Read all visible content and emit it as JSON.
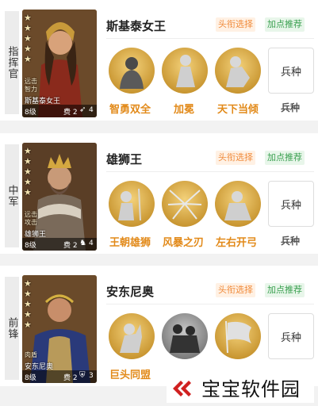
{
  "heroes": [
    {
      "role": "指挥官",
      "name": "斯基泰女王",
      "card": {
        "traits": [
          "远击",
          "智力"
        ],
        "name": "斯基泰女王",
        "level": "8级",
        "cost": "费 2",
        "unit_num": "4",
        "unit_icon": "bow-icon"
      },
      "tag_title": "头衔选择",
      "tag_points": "加点推荐",
      "skills": [
        "智勇双全",
        "加冕",
        "天下当倾"
      ],
      "troop_button": "兵种",
      "troop_label": "兵种"
    },
    {
      "role": "中军",
      "name": "雄狮王",
      "card": {
        "traits": [
          "远击",
          "攻击"
        ],
        "name": "雄狮王",
        "level": "8级",
        "cost": "费 2",
        "unit_num": "4",
        "unit_icon": "horse-icon"
      },
      "tag_title": "头衔选择",
      "tag_points": "加点推荐",
      "skills": [
        "王朝雄狮",
        "风暴之刃",
        "左右开弓"
      ],
      "troop_button": "兵种",
      "troop_label": "兵种"
    },
    {
      "role": "前锋",
      "name": "安东尼奥",
      "card": {
        "traits": [
          "肉盾"
        ],
        "name": "安东尼奥",
        "level": "8级",
        "cost": "费 2",
        "unit_num": "3",
        "unit_icon": "shield-icon"
      },
      "tag_title": "头衔选择",
      "tag_points": "加点推荐",
      "skills": [
        "巨头同盟",
        "",
        ""
      ],
      "troop_button": "兵种",
      "troop_label": ""
    }
  ],
  "watermark": {
    "text": "宝宝软件园",
    "icon": "baobao-logo-icon"
  },
  "colors": {
    "skill_label": "#e28a1a",
    "tag_title": "#f08a3a",
    "tag_points": "#3aa050"
  }
}
